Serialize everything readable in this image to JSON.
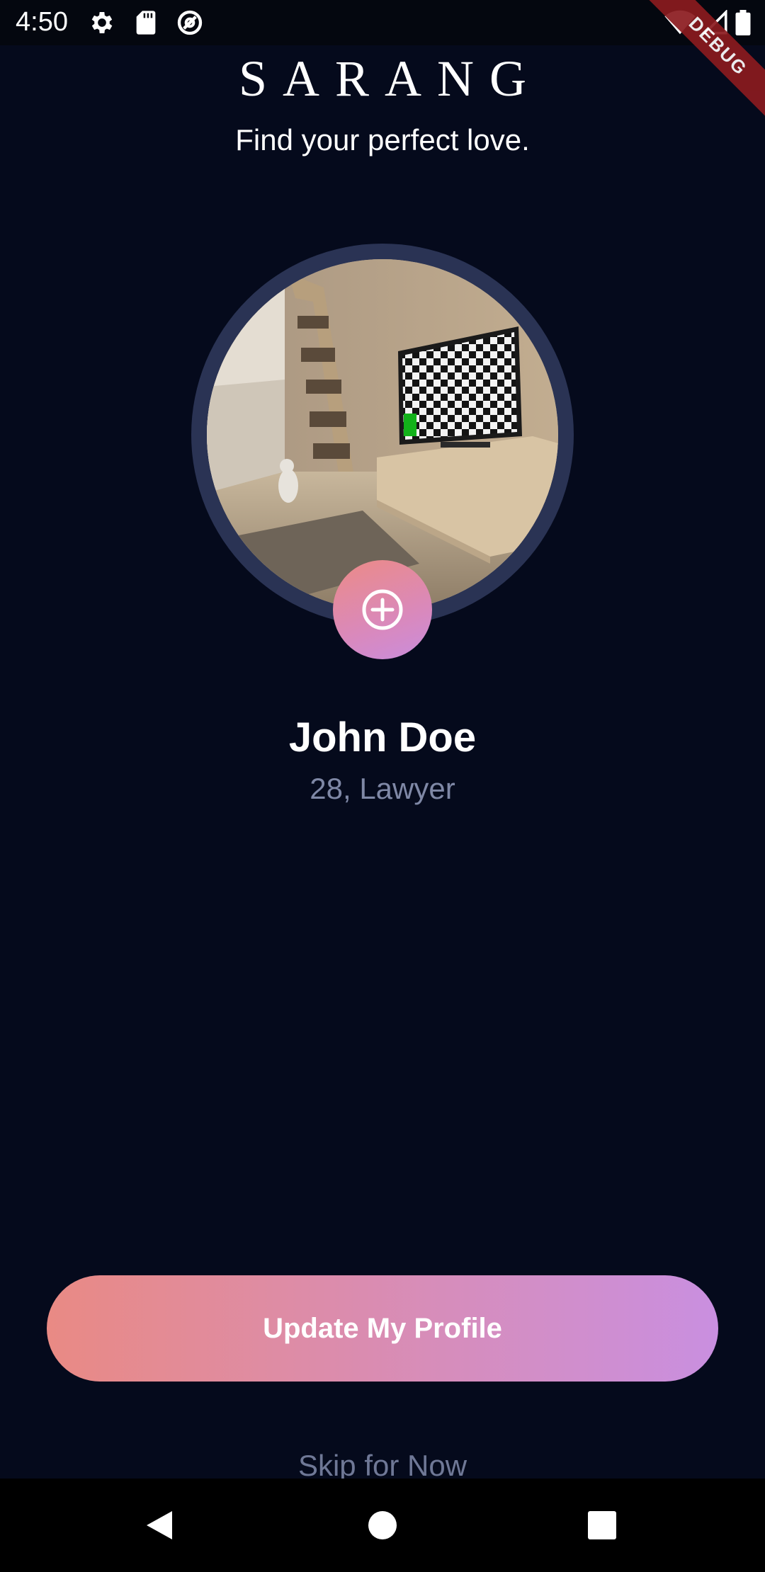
{
  "status_bar": {
    "time": "4:50",
    "left_icons": [
      "settings-icon",
      "sd-card-icon",
      "at-sign-icon"
    ],
    "right_icons": [
      "wifi-icon",
      "cell-signal-icon",
      "battery-icon"
    ]
  },
  "debug_banner": "DEBUG",
  "header": {
    "title": "SARANG",
    "subtitle": "Find your perfect love."
  },
  "profile": {
    "name": "John Doe",
    "meta": "28, Lawyer",
    "add_photo_icon": "add-circle-icon"
  },
  "actions": {
    "update_label": "Update My Profile",
    "skip_label": "Skip for Now"
  },
  "colors": {
    "background": "#050a1c",
    "accent_start": "#e98a84",
    "accent_end": "#c98fe0",
    "muted_text": "#7f88a6"
  },
  "nav_bar": {
    "buttons": [
      "back-icon",
      "home-icon",
      "recents-icon"
    ]
  }
}
